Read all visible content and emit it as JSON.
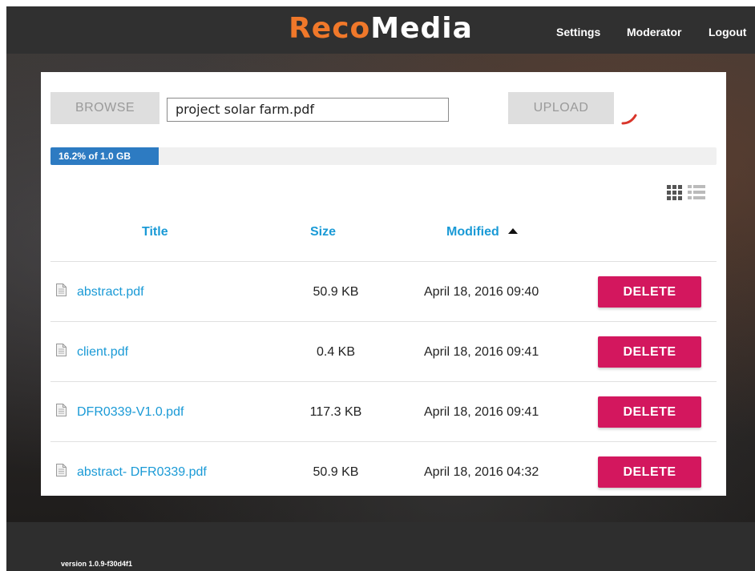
{
  "header": {
    "logo_reco": "Reco",
    "logo_media": "Media",
    "nav": {
      "settings": "Settings",
      "moderator": "Moderator",
      "logout": "Logout"
    }
  },
  "upload": {
    "browse_label": "BROWSE",
    "file_name": "project solar farm.pdf",
    "upload_label": "UPLOAD"
  },
  "quota": {
    "label": "16.2% of 1.0 GB",
    "percent": 16.2
  },
  "table": {
    "columns": {
      "title": "Title",
      "size": "Size",
      "modified": "Modified"
    },
    "sort": {
      "column": "modified",
      "direction": "ascending"
    },
    "rows": [
      {
        "title": "abstract.pdf",
        "size": "50.9 KB",
        "modified": "April 18, 2016 09:40",
        "action": "DELETE"
      },
      {
        "title": "client.pdf",
        "size": "0.4 KB",
        "modified": "April 18, 2016 09:41",
        "action": "DELETE"
      },
      {
        "title": "DFR0339-V1.0.pdf",
        "size": "117.3 KB",
        "modified": "April 18, 2016 09:41",
        "action": "DELETE"
      },
      {
        "title": "abstract- DFR0339.pdf",
        "size": "50.9 KB",
        "modified": "April 18, 2016 04:32",
        "action": "DELETE"
      }
    ]
  },
  "footer": {
    "version": "version 1.0.9-f30d4f1"
  },
  "colors": {
    "accent_orange": "#f0782a",
    "link_blue": "#1a9ad6",
    "delete_pink": "#d3175e",
    "progress_blue": "#2d7bc2",
    "header_dark": "#303030"
  },
  "icons": {
    "spinner": "loading-spinner-icon",
    "grid_view": "grid-view-icon",
    "list_view": "list-view-icon",
    "sort": "sort-ascending-icon",
    "file": "document-icon"
  }
}
